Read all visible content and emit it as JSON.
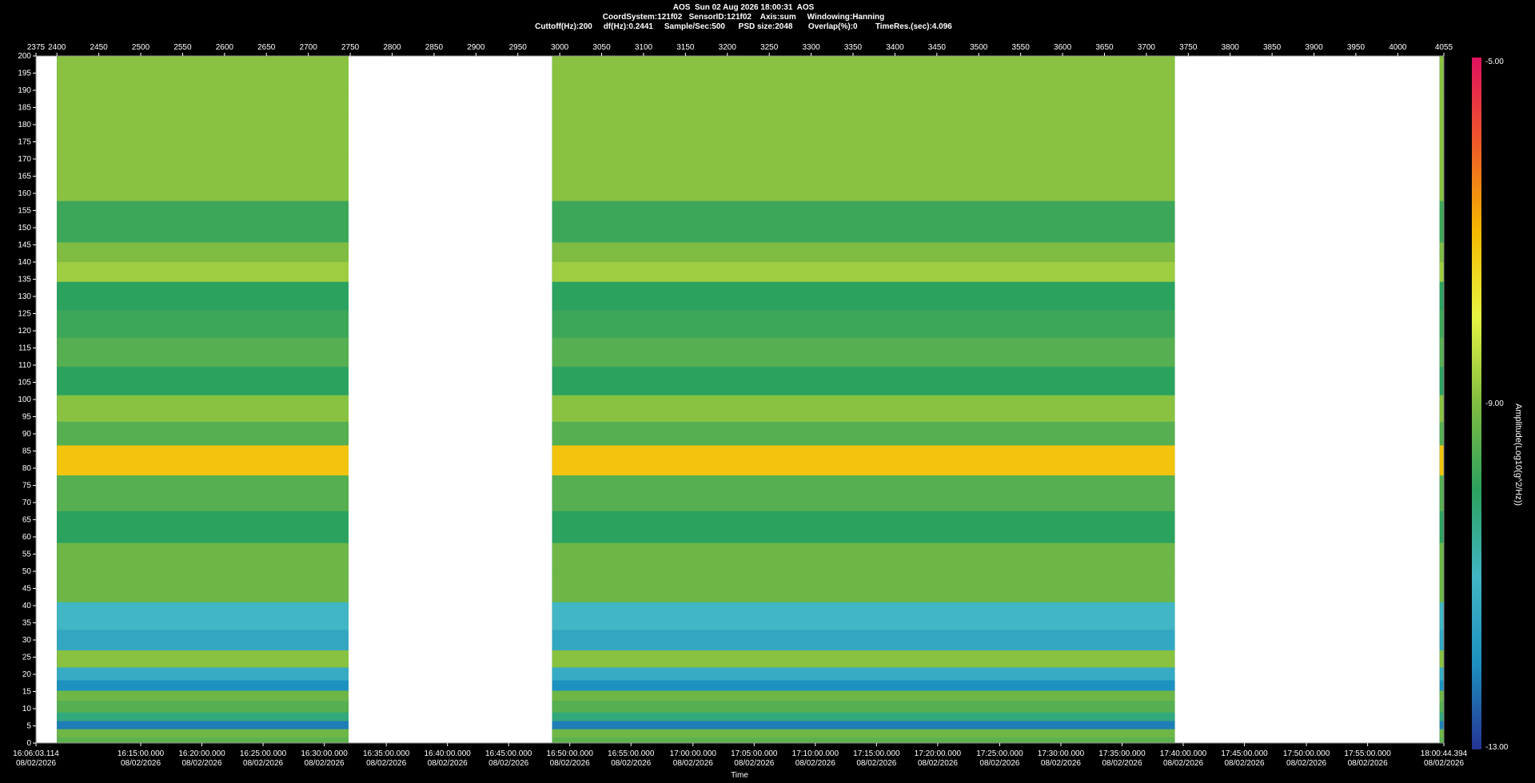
{
  "header": {
    "line1": "AOS  Sun 02 Aug 2026 18:00:31  AOS",
    "line2": "CoordSystem:121f02   SensorID:121f02    Axis:sum     Windowing:Hanning",
    "line3": "Cuttoff(Hz):200     df(Hz):0.2441     Sample/Sec:500      PSD size:2048       Overlap(%):0        TimeRes.(sec):4.096"
  },
  "chart_data": {
    "type": "heatmap",
    "top_axis": {
      "range": [
        2375,
        4055
      ],
      "ticks": [
        2375,
        2400,
        2450,
        2500,
        2550,
        2600,
        2650,
        2700,
        2750,
        2800,
        2850,
        2900,
        2950,
        3000,
        3050,
        3100,
        3150,
        3200,
        3250,
        3300,
        3350,
        3400,
        3450,
        3500,
        3550,
        3600,
        3650,
        3700,
        3750,
        3800,
        3850,
        3900,
        3950,
        4000,
        4055
      ]
    },
    "y_axis": {
      "range": [
        0,
        200
      ],
      "ticks": [
        0,
        5,
        10,
        15,
        20,
        25,
        30,
        35,
        40,
        45,
        50,
        55,
        60,
        65,
        70,
        75,
        80,
        85,
        90,
        95,
        100,
        105,
        110,
        115,
        120,
        125,
        130,
        135,
        140,
        145,
        150,
        155,
        160,
        165,
        170,
        175,
        180,
        185,
        190,
        195,
        200
      ]
    },
    "x_axis": {
      "label": "Time",
      "date_label": "08/02/2026",
      "ticks": [
        {
          "frame": 2375,
          "time": "16:06:03.114"
        },
        {
          "frame": 2500,
          "time": "16:15:00.000"
        },
        {
          "frame": 2573,
          "time": "16:20:00.000"
        },
        {
          "frame": 2646,
          "time": "16:25:00.000"
        },
        {
          "frame": 2719,
          "time": "16:30:00.000"
        },
        {
          "frame": 2793,
          "time": "16:35:00.000"
        },
        {
          "frame": 2866,
          "time": "16:40:00.000"
        },
        {
          "frame": 2939,
          "time": "16:45:00.000"
        },
        {
          "frame": 3012,
          "time": "16:50:00.000"
        },
        {
          "frame": 3085,
          "time": "16:55:00.000"
        },
        {
          "frame": 3159,
          "time": "17:00:00.000"
        },
        {
          "frame": 3232,
          "time": "17:05:00.000"
        },
        {
          "frame": 3305,
          "time": "17:10:00.000"
        },
        {
          "frame": 3378,
          "time": "17:15:00.000"
        },
        {
          "frame": 3451,
          "time": "17:20:00.000"
        },
        {
          "frame": 3525,
          "time": "17:25:00.000"
        },
        {
          "frame": 3598,
          "time": "17:30:00.000"
        },
        {
          "frame": 3671,
          "time": "17:35:00.000"
        },
        {
          "frame": 3744,
          "time": "17:40:00.000"
        },
        {
          "frame": 3817,
          "time": "17:45:00.000"
        },
        {
          "frame": 3891,
          "time": "17:50:00.000"
        },
        {
          "frame": 3964,
          "time": "17:55:00.000"
        },
        {
          "frame": 4055,
          "time": "18:00:44.394"
        }
      ]
    },
    "data_segments": [
      [
        2400,
        2748
      ],
      [
        2991,
        3734
      ],
      [
        4050,
        4055
      ]
    ],
    "gap_segments": [
      [
        2375,
        2400
      ],
      [
        2748,
        2991
      ],
      [
        3734,
        4050
      ]
    ],
    "gap_color": "#ffffff",
    "bands": [
      {
        "freq": 0.6,
        "level": -9.4
      },
      {
        "freq": 2.6,
        "level": -9.2
      },
      {
        "freq": 5.5,
        "level": -12.2
      },
      {
        "freq": 7.3,
        "level": -10.3
      },
      {
        "freq": 10.5,
        "level": -9.5
      },
      {
        "freq": 14,
        "level": -9.2
      },
      {
        "freq": 16.5,
        "level": -12
      },
      {
        "freq": 20,
        "level": -11.3
      },
      {
        "freq": 24,
        "level": -8.9
      },
      {
        "freq": 30,
        "level": -11.4
      },
      {
        "freq": 36,
        "level": -11
      },
      {
        "freq": 46,
        "level": -9.2
      },
      {
        "freq": 53.5,
        "level": -9.2
      },
      {
        "freq": 63,
        "level": -10
      },
      {
        "freq": 72,
        "level": -9.5
      },
      {
        "freq": 83.8,
        "level": -7.2
      },
      {
        "freq": 89.5,
        "level": -9.5
      },
      {
        "freq": 97.5,
        "level": -8.9
      },
      {
        "freq": 105,
        "level": -10
      },
      {
        "freq": 114,
        "level": -9.5
      },
      {
        "freq": 122,
        "level": -9.8
      },
      {
        "freq": 130,
        "level": -10
      },
      {
        "freq": 138.5,
        "level": -8.7
      },
      {
        "freq": 141.5,
        "level": -9
      },
      {
        "freq": 150,
        "level": -9.8
      },
      {
        "freq": 165.5,
        "level": -8.9
      },
      {
        "freq": 177.5,
        "level": -8.9
      },
      {
        "freq": 187.8,
        "level": -8.9
      },
      {
        "freq": 190,
        "level": -8.9
      }
    ],
    "background_level": -10.2,
    "colorbar": {
      "label": "Amplitude(Log10(g^2/Hz))",
      "min": -13.0,
      "max": -5.0,
      "tick_labels": [
        "-5.00",
        "-9.00",
        "-13.00"
      ],
      "colors": [
        "#253494",
        "#1d91c0",
        "#41b6c4",
        "#2ca25f",
        "#7fbc41",
        "#e6f542",
        "#f5b800",
        "#f05a28",
        "#e0115f"
      ]
    }
  }
}
